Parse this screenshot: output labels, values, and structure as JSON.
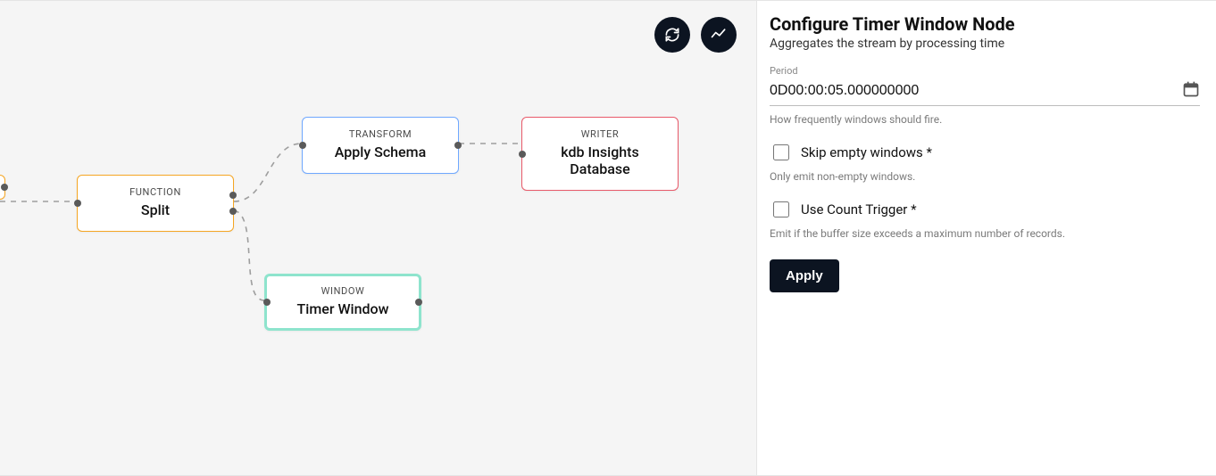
{
  "canvas": {
    "nodes": {
      "split": {
        "type": "FUNCTION",
        "title": "Split"
      },
      "applySchema": {
        "type": "TRANSFORM",
        "title": "Apply Schema"
      },
      "writer": {
        "type": "WRITER",
        "title": "kdb Insights Database"
      },
      "timerWindow": {
        "type": "WINDOW",
        "title": "Timer Window"
      }
    }
  },
  "panel": {
    "heading": "Configure Timer Window Node",
    "subheading": "Aggregates the stream by processing time",
    "period": {
      "label": "Period",
      "value": "0D00:00:05.000000000",
      "hint": "How frequently windows should fire."
    },
    "skipEmpty": {
      "label": "Skip empty windows *",
      "hint": "Only emit non-empty windows."
    },
    "countTrigger": {
      "label": "Use Count Trigger *",
      "hint": "Emit if the buffer size exceeds a maximum number of records."
    },
    "applyLabel": "Apply"
  }
}
